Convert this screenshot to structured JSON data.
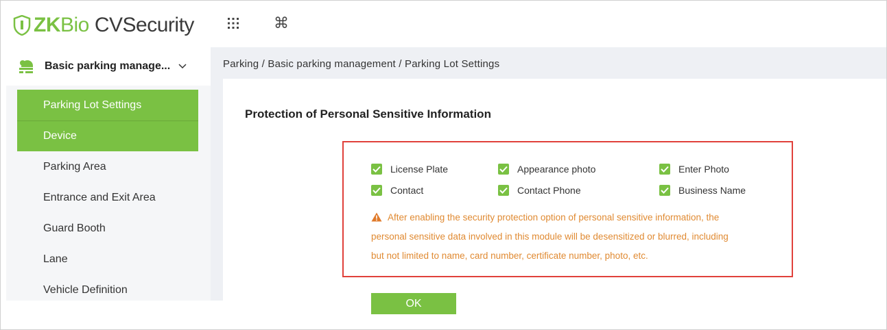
{
  "app": {
    "brand_zk": "ZK",
    "brand_bio": "Bio",
    "brand_product": "CVSecurity",
    "accent_color": "#7ac143",
    "icons": [
      "shield-logo-icon",
      "apps-grid-icon",
      "command-icon"
    ]
  },
  "sidebar": {
    "module_label": "Basic parking manage...",
    "module_icon": "parking-module-icon",
    "items": [
      {
        "label": "Parking Lot Settings",
        "active": true
      },
      {
        "label": "Device",
        "active": true
      },
      {
        "label": "Parking Area",
        "active": false
      },
      {
        "label": "Entrance and Exit Area",
        "active": false
      },
      {
        "label": "Guard Booth",
        "active": false
      },
      {
        "label": "Lane",
        "active": false
      },
      {
        "label": "Vehicle Definition",
        "active": false
      }
    ]
  },
  "breadcrumb": "Parking / Basic parking management / Parking Lot Settings",
  "dialog": {
    "title": "Protection of Personal Sensitive Information",
    "options": [
      {
        "label": "License Plate",
        "checked": true
      },
      {
        "label": "Appearance photo",
        "checked": true
      },
      {
        "label": "Enter Photo",
        "checked": true
      },
      {
        "label": "Contact",
        "checked": true
      },
      {
        "label": "Contact Phone",
        "checked": true
      },
      {
        "label": "Business Name",
        "checked": true
      }
    ],
    "warning_line1": "After enabling the security protection option of personal sensitive information, the",
    "warning_line2": "personal sensitive data involved in this module will be desensitized or blurred, including",
    "warning_line3": "but not limited to name, card number, certificate number, photo, etc.",
    "warning_color": "#e08a32",
    "highlight_border_color": "#e0403a",
    "ok_label": "OK"
  }
}
